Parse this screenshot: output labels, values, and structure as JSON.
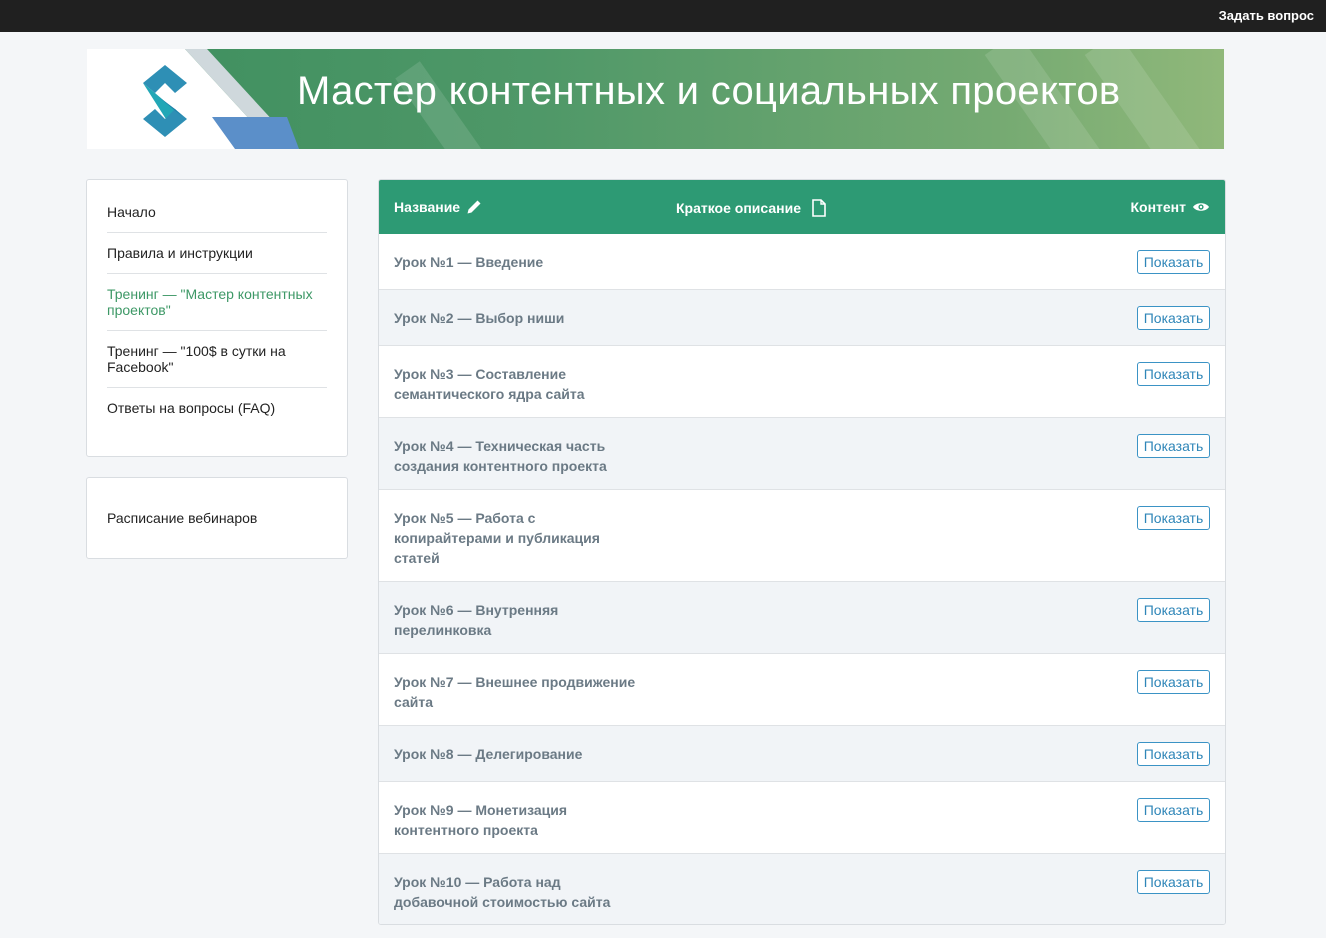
{
  "topbar": {
    "ask_label": "Задать вопрос"
  },
  "banner": {
    "title": "Мастер контентных и социальных проектов",
    "colors": {
      "from": "#3d8e5e",
      "to": "#90b87a",
      "logo_blue": "#2e8fb5",
      "logo_teal": "#22a7b6"
    }
  },
  "sidebar": {
    "items": [
      {
        "label": "Начало"
      },
      {
        "label": "Правила и инструкции"
      },
      {
        "label": "Тренинг — \"Мастер контентных проектов\""
      },
      {
        "label": "Тренинг — \"100$ в сутки на Facebook\""
      },
      {
        "label": "Ответы на вопросы (FAQ)"
      }
    ],
    "webinar_label": "Расписание вебинаров",
    "active_color": "#3d9866"
  },
  "table": {
    "headers": {
      "name": "Название",
      "description": "Краткое описание",
      "content": "Контент"
    },
    "header_color": "#2d9a74",
    "button_label": "Показать",
    "rows": [
      {
        "title": "Урок №1 — Введение"
      },
      {
        "title": "Урок №2 — Выбор ниши"
      },
      {
        "title": "Урок №3 — Составление семантического ядра сайта"
      },
      {
        "title": "Урок №4 — Техническая часть создания контентного проекта"
      },
      {
        "title": "Урок №5 — Работа с копирайтерами и публикация статей"
      },
      {
        "title": "Урок №6 — Внутренняя перелинковка"
      },
      {
        "title": "Урок №7 — Внешнее продвижение сайта"
      },
      {
        "title": "Урок №8 — Делегирование"
      },
      {
        "title": "Урок №9 — Монетизация контентного проекта"
      },
      {
        "title": "Урок №10 — Работа над добавочной стоимостью сайта"
      }
    ]
  },
  "icons": {
    "name_header": "pencil-icon",
    "description_header": "document-icon",
    "content_header": "eye-icon",
    "logo": "logo-icon"
  }
}
